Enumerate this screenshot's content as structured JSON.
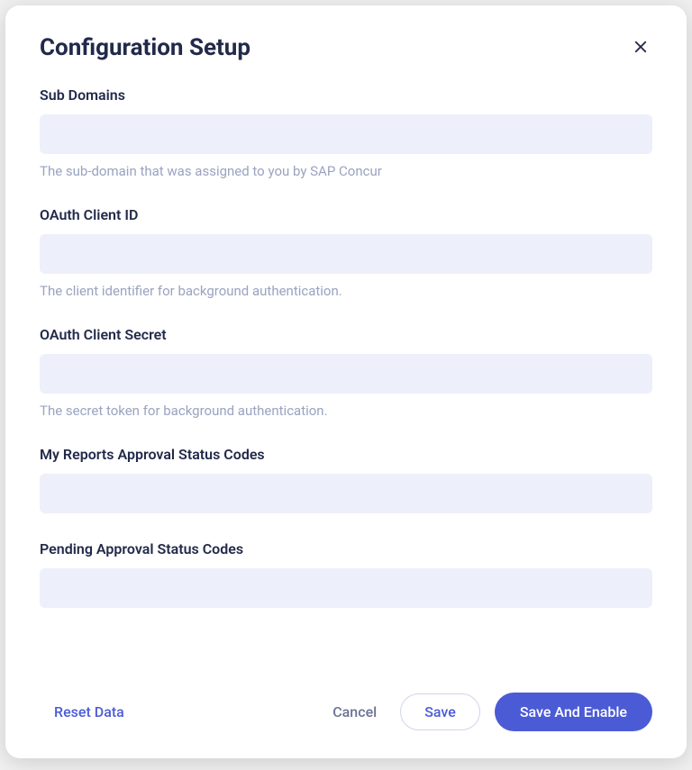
{
  "title": "Configuration Setup",
  "fields": {
    "subDomains": {
      "label": "Sub Domains",
      "value": "",
      "help": "The sub-domain that was assigned to you by SAP Concur"
    },
    "oauthClientId": {
      "label": "OAuth Client ID",
      "value": "",
      "help": "The client identifier for background authentication."
    },
    "oauthClientSecret": {
      "label": "OAuth Client Secret",
      "value": "",
      "help": "The secret token for background authentication."
    },
    "myReportsApprovalStatusCodes": {
      "label": "My Reports Approval Status Codes",
      "value": ""
    },
    "pendingApprovalStatusCodes": {
      "label": "Pending Approval Status Codes",
      "value": ""
    }
  },
  "buttons": {
    "resetData": "Reset Data",
    "cancel": "Cancel",
    "save": "Save",
    "saveAndEnable": "Save And Enable"
  }
}
